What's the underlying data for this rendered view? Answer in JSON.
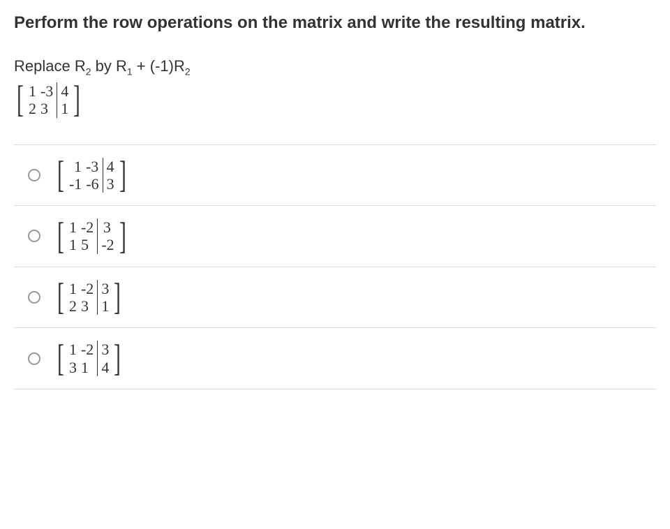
{
  "question": {
    "title": "Perform the row operations on the matrix and write the resulting matrix.",
    "instruction_pre": "Replace R",
    "instruction_sub1": "2",
    "instruction_mid1": " by R",
    "instruction_sub2": "1",
    "instruction_mid2": " + (-1)R",
    "instruction_sub3": "2",
    "matrix": {
      "r1c1": "1",
      "r1c2": "-3",
      "r1aug": "4",
      "r2c1": "2",
      "r2c2": "3",
      "r2aug": "1"
    }
  },
  "options": [
    {
      "r1c1": "1",
      "r1c2": "-3",
      "r1aug": "4",
      "r2c1": "-1",
      "r2c2": "-6",
      "r2aug": "3"
    },
    {
      "r1c1": "1",
      "r1c2": "-2",
      "r1aug": "3",
      "r2c1": "1",
      "r2c2": "5",
      "r2aug": "-2"
    },
    {
      "r1c1": "1",
      "r1c2": "-2",
      "r1aug": "3",
      "r2c1": "2",
      "r2c2": "3",
      "r2aug": "1"
    },
    {
      "r1c1": "1",
      "r1c2": "-2",
      "r1aug": "3",
      "r2c1": "3",
      "r2c2": "1",
      "r2aug": "4"
    }
  ]
}
